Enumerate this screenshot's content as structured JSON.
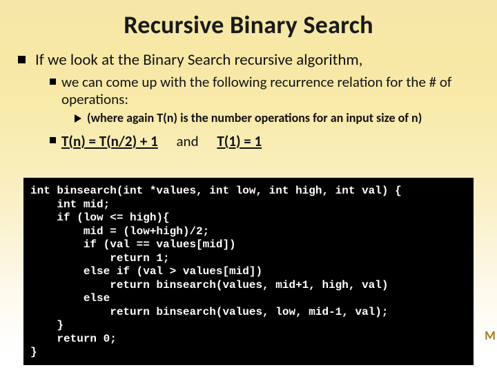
{
  "title": "Recursive Binary Search",
  "bullets": {
    "l1": "If we look at the Binary Search recursive algorithm,",
    "l2": "we can come up with the following recurrence relation for the # of operations:",
    "l3": "(where again T(n) is the number operations for an input size of n)",
    "rec_a": "T(n) = T(n/2) + 1",
    "rec_and": "and",
    "rec_b": "T(1) = 1"
  },
  "code": "int binsearch(int *values, int low, int high, int val) {\n    int mid;\n    if (low <= high){\n        mid = (low+high)/2;\n        if (val == values[mid])\n            return 1;\n        else if (val > values[mid])\n            return binsearch(values, mid+1, high, val)\n        else\n            return binsearch(values, low, mid-1, val);\n    }\n    return 0;\n}",
  "watermark": "M"
}
